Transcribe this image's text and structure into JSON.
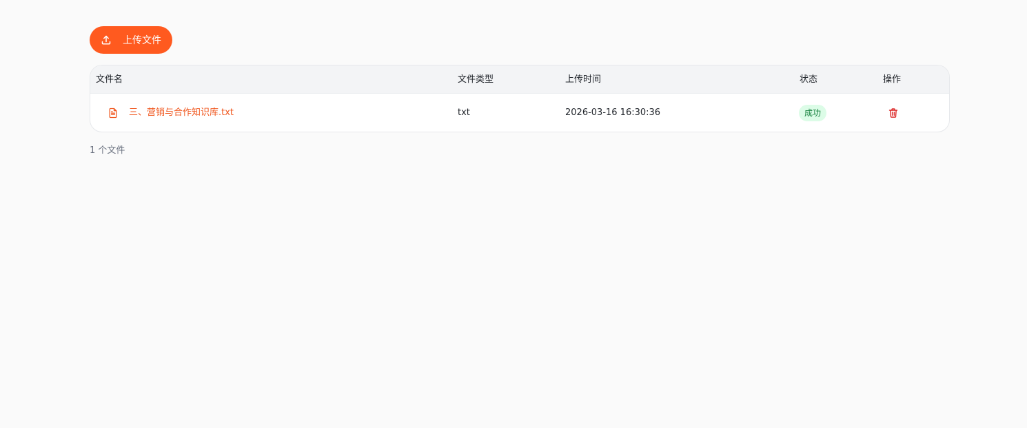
{
  "toolbar": {
    "upload_label": "上传文件",
    "upload_icon": "upload-icon"
  },
  "table": {
    "columns": [
      "文件名",
      "文件类型",
      "上传时间",
      "状态",
      "操作"
    ],
    "rows": [
      {
        "name": "三、营销与合作知识库.txt",
        "type": "txt",
        "uploaded_at": "2026-03-16 16:30:36",
        "status": "成功",
        "icon": "file-text-icon",
        "action_icon": "trash-icon"
      }
    ]
  },
  "footer": {
    "count_text": "1 个文件"
  },
  "colors": {
    "accent": "#ff5a1f",
    "link": "#f0561d",
    "success_bg": "#dcfce7",
    "success_text": "#15803d",
    "danger": "#dc2626"
  }
}
